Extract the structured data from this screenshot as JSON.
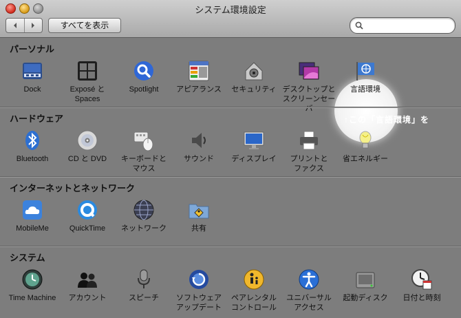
{
  "window": {
    "title": "システム環境設定"
  },
  "toolbar": {
    "back_icon": "chevron-left-icon",
    "forward_icon": "chevron-right-icon",
    "show_all_label": "すべてを表示",
    "search_placeholder": ""
  },
  "sections": [
    {
      "title": "パーソナル",
      "items": [
        {
          "label": "Dock",
          "icon": "dock-icon"
        },
        {
          "label": "Exposé と\nSpaces",
          "icon": "expose-icon"
        },
        {
          "label": "Spotlight",
          "icon": "spotlight-icon"
        },
        {
          "label": "アピアランス",
          "icon": "appearance-icon"
        },
        {
          "label": "セキュリティ",
          "icon": "security-house-icon"
        },
        {
          "label": "デスクトップと\nスクリーンセーバ",
          "icon": "desktop-icon"
        },
        {
          "label": "言語環境",
          "icon": "language-flag-icon"
        }
      ]
    },
    {
      "title": "ハードウェア",
      "items": [
        {
          "label": "Bluetooth",
          "icon": "bluetooth-icon"
        },
        {
          "label": "CD と DVD",
          "icon": "cd-dvd-icon"
        },
        {
          "label": "キーボードと\nマウス",
          "icon": "keyboard-mouse-icon"
        },
        {
          "label": "サウンド",
          "icon": "speaker-icon"
        },
        {
          "label": "ディスプレイ",
          "icon": "display-icon"
        },
        {
          "label": "プリントと\nファクス",
          "icon": "printer-icon"
        },
        {
          "label": "省エネルギー",
          "icon": "lightbulb-icon"
        }
      ]
    },
    {
      "title": "インターネットとネットワーク",
      "items": [
        {
          "label": "MobileMe",
          "icon": "cloud-icon"
        },
        {
          "label": "QuickTime",
          "icon": "quicktime-icon"
        },
        {
          "label": "ネットワーク",
          "icon": "network-globe-icon"
        },
        {
          "label": "共有",
          "icon": "sharing-folder-icon"
        }
      ]
    },
    {
      "title": "システム",
      "items": [
        {
          "label": "Time Machine",
          "icon": "time-machine-icon"
        },
        {
          "label": "アカウント",
          "icon": "accounts-icon"
        },
        {
          "label": "スピーチ",
          "icon": "microphone-icon"
        },
        {
          "label": "ソフトウェア\nアップデート",
          "icon": "software-update-icon"
        },
        {
          "label": "ペアレンタル\nコントロール",
          "icon": "parental-controls-icon"
        },
        {
          "label": "ユニバーサル\nアクセス",
          "icon": "universal-access-icon"
        },
        {
          "label": "起動ディスク",
          "icon": "startup-disk-icon"
        },
        {
          "label": "日付と時刻",
          "icon": "date-time-icon"
        }
      ]
    }
  ],
  "annotation": {
    "text": "↑この「言語環境」を"
  },
  "colors": {
    "background": "#7d7d7d",
    "toolbar_top": "#cfcfcf",
    "toolbar_bottom": "#a9a9a9",
    "annotation_text": "#ffffff"
  }
}
